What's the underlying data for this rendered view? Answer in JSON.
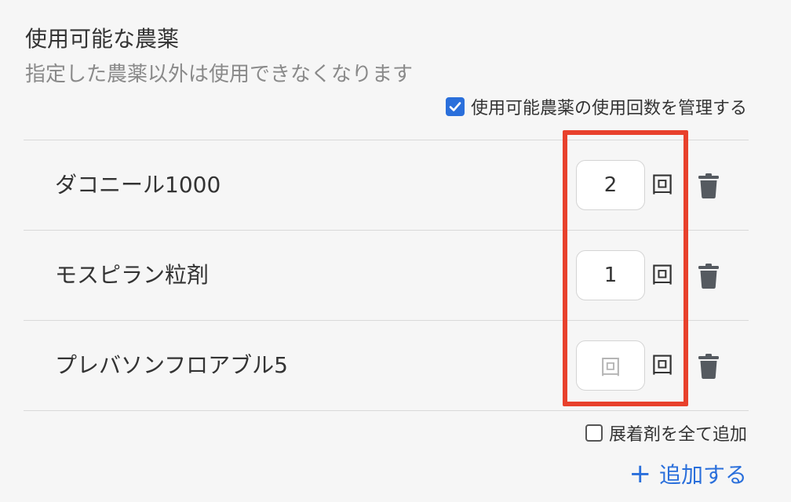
{
  "section": {
    "title": "使用可能な農薬",
    "subtitle": "指定した農薬以外は使用できなくなります"
  },
  "manage_usage": {
    "label": "使用可能農薬の使用回数を管理する",
    "checked": true
  },
  "pesticides": [
    {
      "name": "ダコニール1000",
      "count": "2",
      "unit": "回",
      "trash_icon": "trash-icon"
    },
    {
      "name": "モスピラン粒剤",
      "count": "1",
      "unit": "回",
      "trash_icon": "trash-icon"
    },
    {
      "name": "プレバソンフロアブル5",
      "count": "",
      "placeholder": "回",
      "unit": "回",
      "trash_icon": "trash-icon"
    }
  ],
  "add_all_spreaders": {
    "label": "展着剤を全て追加",
    "checked": false
  },
  "add_button": {
    "label": "追加する",
    "icon": "plus-icon"
  },
  "colors": {
    "accent": "#2a6fdb",
    "highlight": "#e8412c"
  }
}
